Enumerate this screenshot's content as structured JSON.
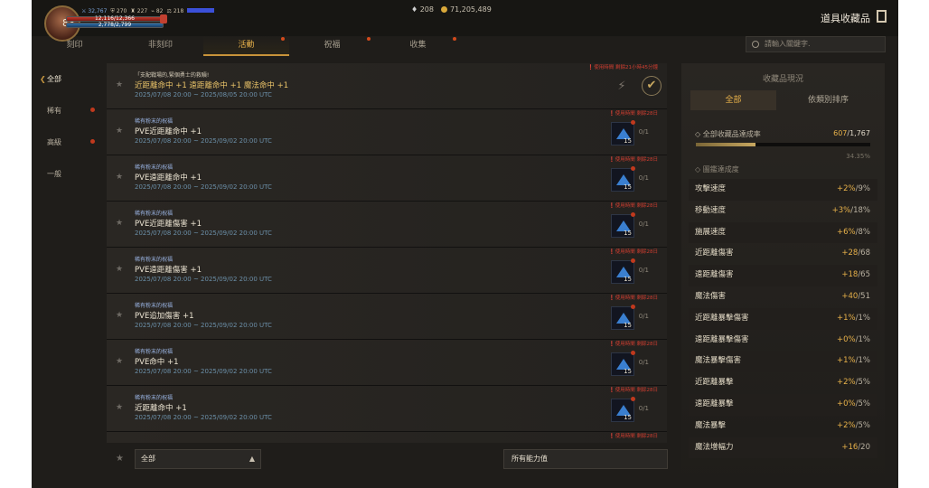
{
  "header": {
    "level": "83",
    "stats": [
      "32,767",
      "270",
      "227",
      "82",
      "218"
    ],
    "hp": "12,116/12,366",
    "mp": "2,778/2,799",
    "gems": "208",
    "gold": "71,205,489",
    "title": "道具收藏品"
  },
  "tabs": [
    {
      "label": "刻印",
      "dot": false
    },
    {
      "label": "非刻印",
      "dot": false
    },
    {
      "label": "活動",
      "dot": true,
      "active": true
    },
    {
      "label": "祝福",
      "dot": true
    },
    {
      "label": "收集",
      "dot": true
    }
  ],
  "search": {
    "placeholder": "請輸入關鍵字."
  },
  "sidebar": [
    {
      "label": "全部",
      "active": true,
      "dot": false
    },
    {
      "label": "稀有",
      "dot": true
    },
    {
      "label": "高級",
      "dot": true
    },
    {
      "label": "一般",
      "dot": false
    }
  ],
  "rows": [
    {
      "sub": "「支配戰場的,緊個勇士的救贖!",
      "name": "近距離命中 +1 遠距離命中 +1 魔法命中 +1",
      "date": "2025/07/08 20:00 ~ 2025/08/05 20:00 UTC",
      "time": "使用時間 剩餘21小時45分鐘",
      "type": "first"
    },
    {
      "sub": "稀有粉末的祝福",
      "name": "PVE近距離命中 +1",
      "date": "2025/07/08 20:00 ~ 2025/09/02 20:00 UTC",
      "time": "使用時間 剩餘28日",
      "count": "15",
      "prog": "0/1"
    },
    {
      "sub": "稀有粉末的祝福",
      "name": "PVE遠距離命中 +1",
      "date": "2025/07/08 20:00 ~ 2025/09/02 20:00 UTC",
      "time": "使用時間 剩餘28日",
      "count": "15",
      "prog": "0/1"
    },
    {
      "sub": "稀有粉末的祝福",
      "name": "PVE近距離傷害 +1",
      "date": "2025/07/08 20:00 ~ 2025/09/02 20:00 UTC",
      "time": "使用時間 剩餘28日",
      "count": "15",
      "prog": "0/1"
    },
    {
      "sub": "稀有粉末的祝福",
      "name": "PVE遠距離傷害 +1",
      "date": "2025/07/08 20:00 ~ 2025/09/02 20:00 UTC",
      "time": "使用時間 剩餘28日",
      "count": "15",
      "prog": "0/1"
    },
    {
      "sub": "稀有粉末的祝福",
      "name": "PVE追加傷害 +1",
      "date": "2025/07/08 20:00 ~ 2025/09/02 20:00 UTC",
      "time": "使用時間 剩餘28日",
      "count": "15",
      "prog": "0/1"
    },
    {
      "sub": "稀有粉末的祝福",
      "name": "PVE命中 +1",
      "date": "2025/07/08 20:00 ~ 2025/09/02 20:00 UTC",
      "time": "使用時間 剩餘28日",
      "count": "15",
      "prog": "0/1"
    },
    {
      "sub": "稀有粉末的祝福",
      "name": "近距離命中 +1",
      "date": "2025/07/08 20:00 ~ 2025/09/02 20:00 UTC",
      "time": "使用時間 剩餘28日",
      "count": "15",
      "prog": "0/1"
    },
    {
      "sub": "",
      "name": "",
      "date": "",
      "time": "使用時間 剩餘28日",
      "count": "",
      "prog": ""
    }
  ],
  "filter": {
    "category": "全部",
    "ability": "所有能力值"
  },
  "panel": {
    "title": "收藏品現況",
    "tab_all": "全部",
    "tab_sort": "依類別排序",
    "overall_label": "◇ 全部收藏品達成率",
    "overall_done": "607",
    "overall_total": "/1,767",
    "progress": 0.3435,
    "pct": "34.35%",
    "section": "◇ 圖鑑達成度",
    "stats": [
      {
        "name": "攻擊速度",
        "cur": "+2%",
        "max": "/9%"
      },
      {
        "name": "移動速度",
        "cur": "+3%",
        "max": "/18%"
      },
      {
        "name": "施展速度",
        "cur": "+6%",
        "max": "/8%"
      },
      {
        "name": "近距離傷害",
        "cur": "+28",
        "max": "/68"
      },
      {
        "name": "遠距離傷害",
        "cur": "+18",
        "max": "/65"
      },
      {
        "name": "魔法傷害",
        "cur": "+40",
        "max": "/51"
      },
      {
        "name": "近距離暴擊傷害",
        "cur": "+1%",
        "max": "/1%"
      },
      {
        "name": "遠距離暴擊傷害",
        "cur": "+0%",
        "max": "/1%"
      },
      {
        "name": "魔法暴擊傷害",
        "cur": "+1%",
        "max": "/1%"
      },
      {
        "name": "近距離暴擊",
        "cur": "+2%",
        "max": "/5%"
      },
      {
        "name": "遠距離暴擊",
        "cur": "+0%",
        "max": "/5%"
      },
      {
        "name": "魔法暴擊",
        "cur": "+2%",
        "max": "/5%"
      },
      {
        "name": "魔法增幅力",
        "cur": "+16",
        "max": "/20"
      }
    ]
  },
  "colors": {
    "accent": "#e7b14a",
    "alert": "#c0391d",
    "bg": "#1f1d1a"
  }
}
